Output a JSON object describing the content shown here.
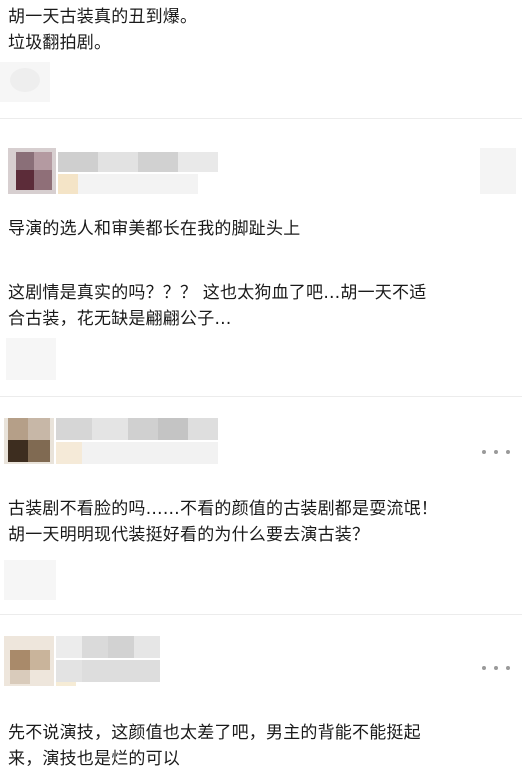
{
  "comments": [
    {
      "lines": [
        "胡一天古装真的丑到爆。",
        "垃圾翻拍剧。"
      ]
    },
    {
      "lines": [
        "导演的选人和审美都长在我的脚趾头上"
      ]
    },
    {
      "lines": [
        "这剧情是真实的吗？？？ 这也太狗血了吧…胡一天不适",
        "合古装，花无缺是翩翩公子…"
      ]
    },
    {
      "lines": [
        "古装剧不看脸的吗……不看的颜值的古装剧都是耍流氓！",
        "胡一天明明现代装挺好看的为什么要去演古装？"
      ]
    },
    {
      "lines": [
        "先不说演技，这颜值也太差了吧，男主的背能不能挺起",
        "来，演技也是烂的可以"
      ]
    }
  ],
  "icons": {
    "avatar": "blurred-avatar-icon",
    "more": "more-options-icon"
  },
  "colors": {
    "text": "#1a1a1a",
    "divider": "#ececec",
    "more_dots": "#9a9a9a"
  }
}
